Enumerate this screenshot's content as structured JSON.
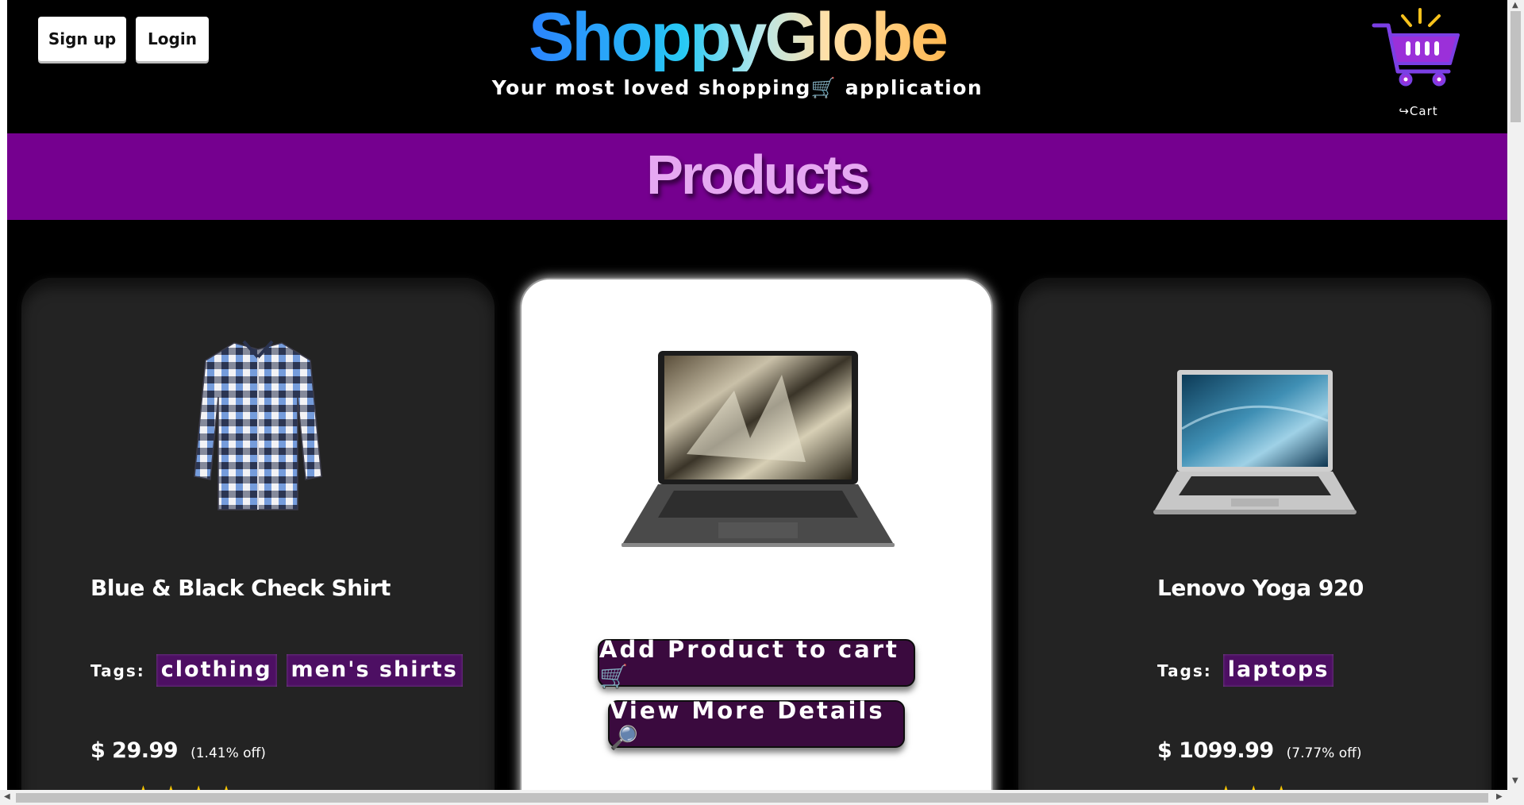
{
  "header": {
    "signup_label": "Sign up",
    "login_label": "Login",
    "logo": "ShoppyGlobe",
    "tagline": "Your most loved shopping🛒 application",
    "cart_label": "↪Cart",
    "cart_icon": "shopping-cart-icon"
  },
  "products_heading": "Products",
  "colors": {
    "band": "#75008f",
    "tag_bg": "#4d0f63",
    "card_bg": "#232323",
    "button_bg": "#3a0a3e",
    "star": "#f5c400"
  },
  "products": [
    {
      "title": "Blue & Black Check Shirt",
      "tags_label": "Tags:",
      "tags": [
        "clothing",
        "men's shirts"
      ],
      "price": "$ 29.99",
      "discount": "(1.41% off)",
      "image_icon": "checked-shirt-image"
    },
    {
      "image_icon": "laptop-image",
      "add_to_cart_label": "Add Product to cart🛒",
      "view_details_label": "View More Details🔎"
    },
    {
      "title": "Lenovo Yoga 920",
      "tags_label": "Tags:",
      "tags": [
        "laptops"
      ],
      "price": "$ 1099.99",
      "discount": "(7.77% off)",
      "image_icon": "laptop-image"
    }
  ]
}
